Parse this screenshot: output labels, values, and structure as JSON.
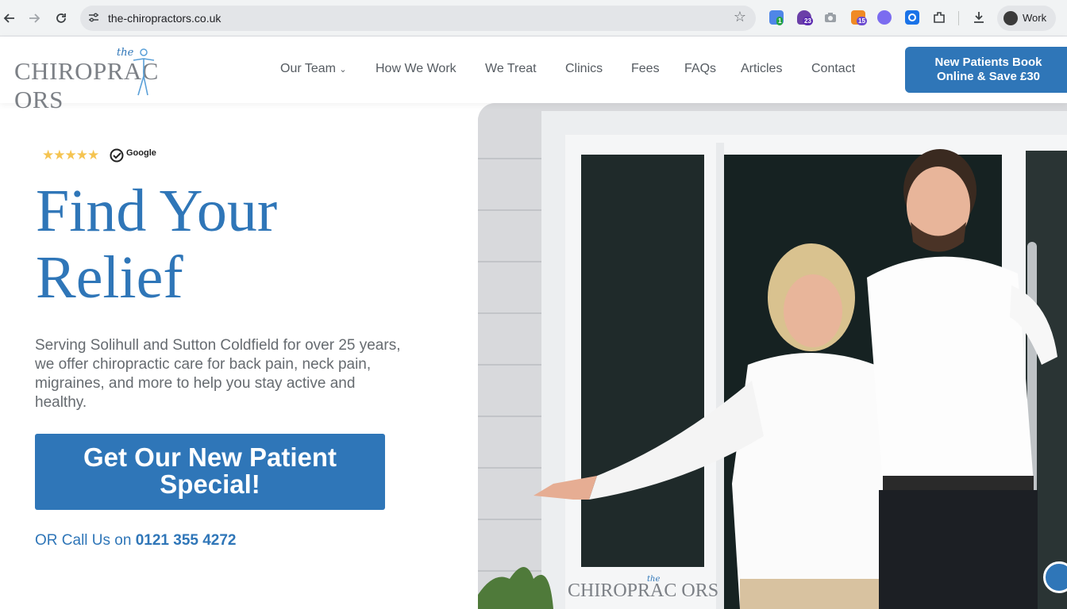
{
  "browser": {
    "url": "the-chiropractors.co.uk",
    "profile_label": "Work",
    "ext_badges": [
      "1",
      "23",
      "15"
    ],
    "icons": [
      "back-icon",
      "forward-icon",
      "reload-icon",
      "site-settings-icon",
      "bookmark-star-icon",
      "extensions-icon",
      "download-icon"
    ]
  },
  "header": {
    "logo_the": "the",
    "logo_word": "CHIROPRAC  ORS",
    "nav": [
      "Our Team",
      "How We Work",
      "We Treat",
      "Clinics",
      "Fees",
      "FAQs",
      "Articles",
      "Contact"
    ],
    "cta_line1": "New Patients Book",
    "cta_line2": "Online & Save £30"
  },
  "hero": {
    "rating_stars": "★★★★★",
    "rating_source": "Google",
    "headline_line1": "Find Your",
    "headline_line2": "Relief",
    "lead": "Serving Solihull and Sutton Coldfield for over 25 years, we offer chiropractic care for back pain, neck pain, migraines, and more to help you stay active and healthy.",
    "cta_line1": "Get Our New Patient",
    "cta_line2": "Special!",
    "call_prefix": "OR Call Us on ",
    "phone": "0121 355 4272",
    "photo_logo_the": "the",
    "photo_logo_word": "CHIROPRAC  ORS"
  },
  "colors": {
    "brand": "#2f76b8",
    "text_grey": "#666b70",
    "star": "#f5c451"
  }
}
